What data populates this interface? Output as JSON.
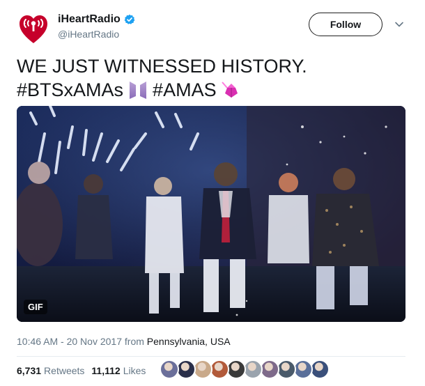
{
  "account": {
    "display_name": "iHeartRadio",
    "handle": "@iHeartRadio",
    "verified": true,
    "brand_color": "#c6002b"
  },
  "follow_button": {
    "label": "Follow"
  },
  "tweet": {
    "line1": "WE JUST WITNESSED HISTORY.",
    "hashtag1": "#BTSxAMAs",
    "hashtag2": "#AMAS",
    "emoji1": "bts-logo-emoji",
    "emoji2": "amas-crystal-emoji"
  },
  "media": {
    "badge": "GIF"
  },
  "meta": {
    "timestamp": "10:46 AM - 20 Nov 2017",
    "from_label": "from",
    "location": "Pennsylvania, USA"
  },
  "stats": {
    "retweets_count": "6,731",
    "retweets_label": "Retweets",
    "likes_count": "11,112",
    "likes_label": "Likes"
  },
  "likers": [
    {
      "color": "#6b6f9a"
    },
    {
      "color": "#2a2f4a"
    },
    {
      "color": "#c9a98a"
    },
    {
      "color": "#b25a3a"
    },
    {
      "color": "#3a3a3a"
    },
    {
      "color": "#9aa3ad"
    },
    {
      "color": "#7e6a8a"
    },
    {
      "color": "#4a5a6a"
    },
    {
      "color": "#5a6f9a"
    },
    {
      "color": "#3a4f7a"
    }
  ]
}
